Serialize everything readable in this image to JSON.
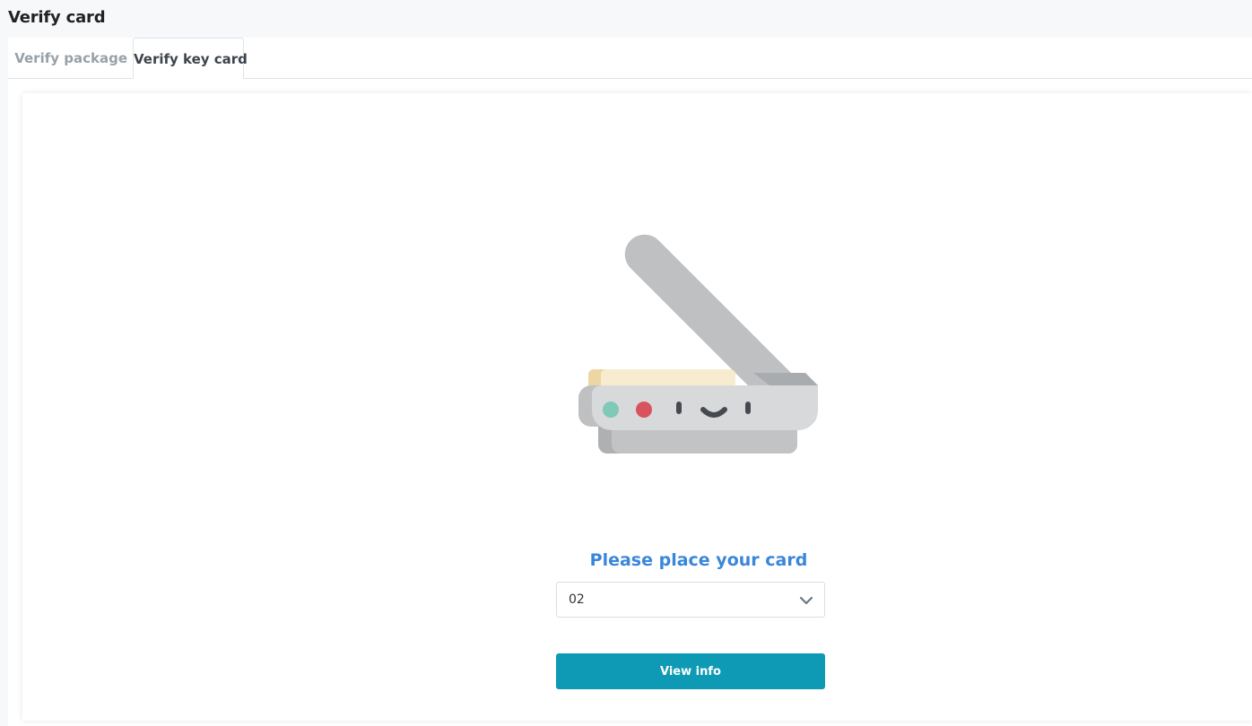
{
  "page": {
    "title": "Verify card"
  },
  "tabs": [
    {
      "label": "Verify package",
      "active": false
    },
    {
      "label": "Verify key card",
      "active": true
    }
  ],
  "main": {
    "illustration_icon": "card-scanner-icon",
    "prompt": "Please place your card",
    "select": {
      "value": "02"
    },
    "view_button_label": "View info"
  },
  "colors": {
    "accent": "#0e9ab4",
    "prompt": "#3a86d9"
  }
}
